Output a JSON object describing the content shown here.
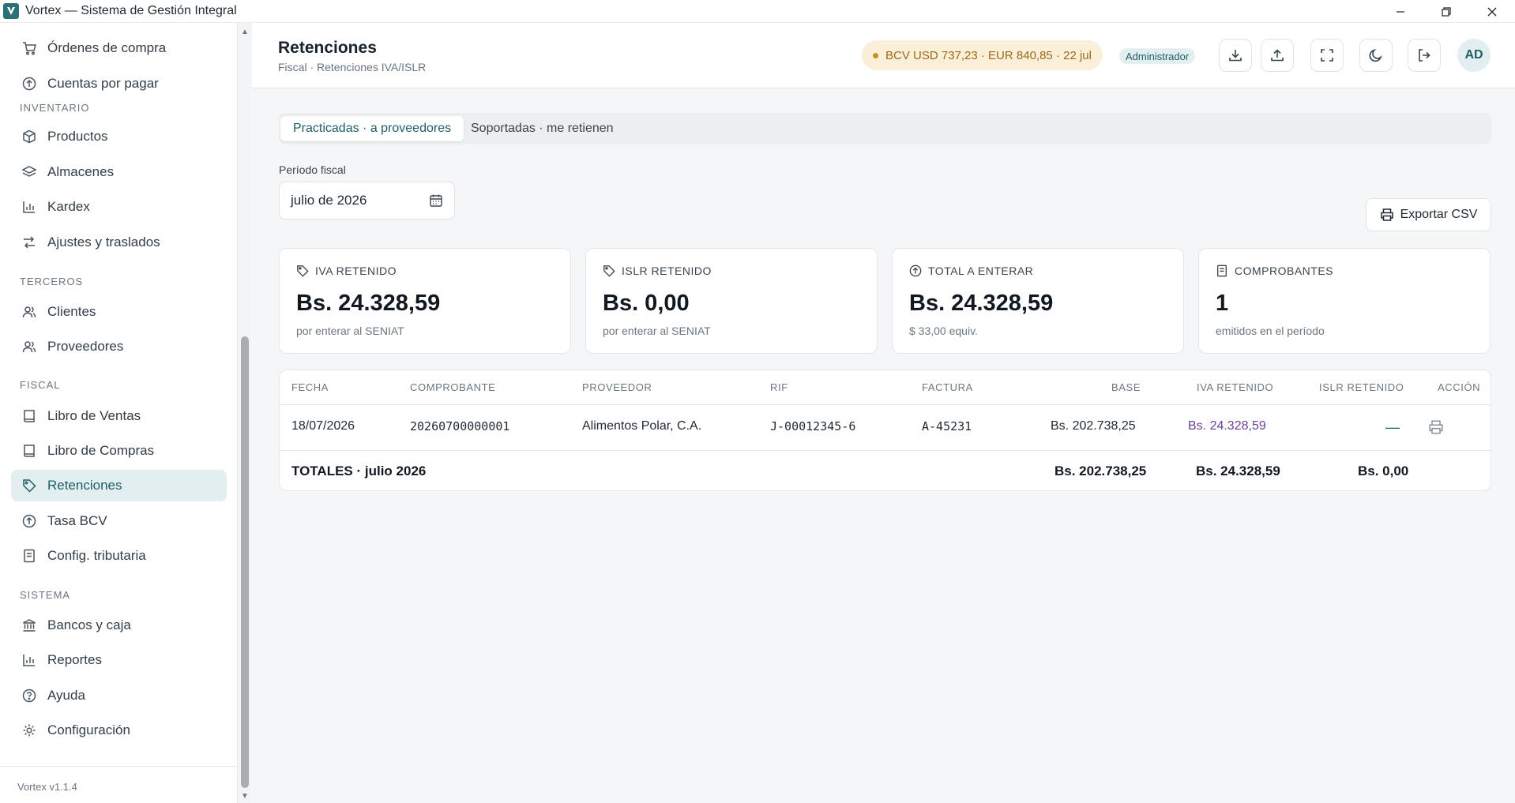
{
  "window": {
    "title": "Vortex — Sistema de Gestión Integral"
  },
  "sidebar": {
    "items_top": [
      {
        "label": "Órdenes de compra",
        "icon": "cart-icon"
      },
      {
        "label": "Cuentas por pagar",
        "icon": "circle-arrow-icon"
      }
    ],
    "sections": [
      {
        "title": "INVENTARIO",
        "items": [
          {
            "label": "Productos",
            "icon": "box-icon"
          },
          {
            "label": "Almacenes",
            "icon": "layers-icon"
          },
          {
            "label": "Kardex",
            "icon": "bar-chart-icon"
          },
          {
            "label": "Ajustes y traslados",
            "icon": "swap-icon"
          }
        ]
      },
      {
        "title": "TERCEROS",
        "items": [
          {
            "label": "Clientes",
            "icon": "users-icon"
          },
          {
            "label": "Proveedores",
            "icon": "users-icon"
          }
        ]
      },
      {
        "title": "FISCAL",
        "items": [
          {
            "label": "Libro de Ventas",
            "icon": "book-icon"
          },
          {
            "label": "Libro de Compras",
            "icon": "book-icon"
          },
          {
            "label": "Retenciones",
            "icon": "tag-icon"
          },
          {
            "label": "Tasa BCV",
            "icon": "circle-arrow-icon"
          },
          {
            "label": "Config. tributaria",
            "icon": "document-icon"
          }
        ]
      },
      {
        "title": "SISTEMA",
        "items": [
          {
            "label": "Bancos y caja",
            "icon": "bank-icon"
          },
          {
            "label": "Reportes",
            "icon": "bar-chart-icon"
          },
          {
            "label": "Ayuda",
            "icon": "help-icon"
          },
          {
            "label": "Configuración",
            "icon": "gear-icon"
          }
        ]
      }
    ],
    "active": "Retenciones",
    "version": "Vortex v1.1.4"
  },
  "header": {
    "title": "Retenciones",
    "breadcrumb": "Fiscal · Retenciones IVA/ISLR",
    "rate": "BCV USD 737,23 · EUR 840,85 · 22 jul",
    "role": "Administrador",
    "avatar": "AD"
  },
  "tabs": [
    {
      "label": "Practicadas · a proveedores",
      "active": true
    },
    {
      "label": "Soportadas · me retienen",
      "active": false
    }
  ],
  "period": {
    "label": "Período fiscal",
    "value": "julio de 2026"
  },
  "export_label": "Exportar CSV",
  "cards": [
    {
      "title": "IVA RETENIDO",
      "value": "Bs. 24.328,59",
      "sub": "por enterar al SENIAT",
      "icon": "tag-icon"
    },
    {
      "title": "ISLR RETENIDO",
      "value": "Bs. 0,00",
      "sub": "por enterar al SENIAT",
      "icon": "tag-icon"
    },
    {
      "title": "TOTAL A ENTERAR",
      "value": "Bs. 24.328,59",
      "sub": "$ 33,00 equiv.",
      "icon": "circle-arrow-icon"
    },
    {
      "title": "COMPROBANTES",
      "value": "1",
      "sub": "emitidos en el período",
      "icon": "document-icon"
    }
  ],
  "table": {
    "columns": [
      "FECHA",
      "COMPROBANTE",
      "PROVEEDOR",
      "RIF",
      "FACTURA",
      "BASE",
      "IVA RETENIDO",
      "ISLR RETENIDO",
      "ACCIÓN"
    ],
    "rows": [
      {
        "fecha": "18/07/2026",
        "comprobante": "20260700000001",
        "proveedor": "Alimentos Polar, C.A.",
        "rif": "J-00012345-6",
        "factura": "A-45231",
        "base": "Bs. 202.738,25",
        "iva": "Bs. 24.328,59",
        "islr": "—"
      }
    ],
    "totals": {
      "label": "TOTALES · julio 2026",
      "base": "Bs. 202.738,25",
      "iva": "Bs. 24.328,59",
      "islr": "Bs. 0,00"
    }
  }
}
